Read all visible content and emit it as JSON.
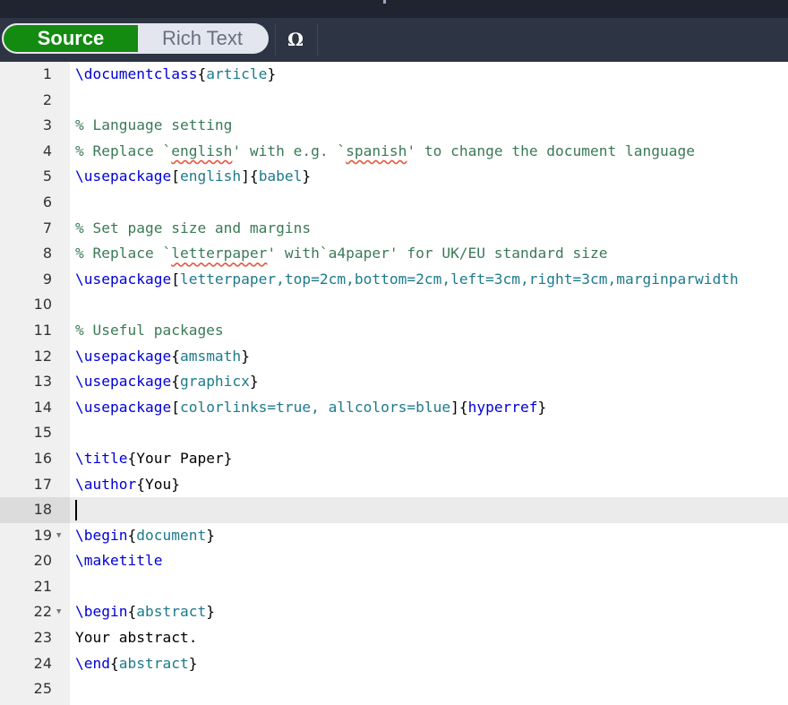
{
  "toolbar": {
    "mode_toggle": {
      "source_label": "Source",
      "rich_text_label": "Rich Text",
      "active": "Source"
    },
    "symbol_button_label": "Ω"
  },
  "colors": {
    "source_active": "#138a10",
    "command": "#0000d8",
    "argument": "#1e7a8c",
    "comment": "#3b7a57",
    "spellcheck_underline": "#e8553a"
  },
  "editor": {
    "active_line": 18,
    "lines": [
      {
        "n": "1",
        "tokens": [
          {
            "t": "cmd",
            "v": "\\documentclass"
          },
          {
            "t": "txt",
            "v": "{"
          },
          {
            "t": "arg",
            "v": "article"
          },
          {
            "t": "txt",
            "v": "}"
          }
        ]
      },
      {
        "n": "2",
        "tokens": []
      },
      {
        "n": "3",
        "tokens": [
          {
            "t": "cmt",
            "v": "% Language setting"
          }
        ]
      },
      {
        "n": "4",
        "tokens": [
          {
            "t": "cmt",
            "v": "% Replace `"
          },
          {
            "t": "cmt err",
            "v": "english"
          },
          {
            "t": "cmt",
            "v": "' with e.g. `"
          },
          {
            "t": "cmt err",
            "v": "spanish"
          },
          {
            "t": "cmt",
            "v": "' to change the document language"
          }
        ]
      },
      {
        "n": "5",
        "tokens": [
          {
            "t": "cmd",
            "v": "\\usepackage"
          },
          {
            "t": "txt",
            "v": "["
          },
          {
            "t": "arg",
            "v": "english"
          },
          {
            "t": "txt",
            "v": "]{"
          },
          {
            "t": "arg",
            "v": "babel"
          },
          {
            "t": "txt",
            "v": "}"
          }
        ]
      },
      {
        "n": "6",
        "tokens": []
      },
      {
        "n": "7",
        "tokens": [
          {
            "t": "cmt",
            "v": "% Set page size and margins"
          }
        ]
      },
      {
        "n": "8",
        "tokens": [
          {
            "t": "cmt",
            "v": "% Replace `"
          },
          {
            "t": "cmt err",
            "v": "letterpaper"
          },
          {
            "t": "cmt",
            "v": "' with`a4paper' for UK/EU standard size"
          }
        ]
      },
      {
        "n": "9",
        "tokens": [
          {
            "t": "cmd",
            "v": "\\usepackage"
          },
          {
            "t": "txt",
            "v": "["
          },
          {
            "t": "arg",
            "v": "letterpaper,top=2cm,bottom=2cm,left=3cm,right=3cm,marginparwidth"
          }
        ]
      },
      {
        "n": "10",
        "tokens": []
      },
      {
        "n": "11",
        "tokens": [
          {
            "t": "cmt",
            "v": "% Useful packages"
          }
        ]
      },
      {
        "n": "12",
        "tokens": [
          {
            "t": "cmd",
            "v": "\\usepackage"
          },
          {
            "t": "txt",
            "v": "{"
          },
          {
            "t": "arg",
            "v": "amsmath"
          },
          {
            "t": "txt",
            "v": "}"
          }
        ]
      },
      {
        "n": "13",
        "tokens": [
          {
            "t": "cmd",
            "v": "\\usepackage"
          },
          {
            "t": "txt",
            "v": "{"
          },
          {
            "t": "arg",
            "v": "graphicx"
          },
          {
            "t": "txt",
            "v": "}"
          }
        ]
      },
      {
        "n": "14",
        "tokens": [
          {
            "t": "cmd",
            "v": "\\usepackage"
          },
          {
            "t": "txt",
            "v": "["
          },
          {
            "t": "arg",
            "v": "colorlinks=true, allcolors=blue"
          },
          {
            "t": "txt",
            "v": "]{"
          },
          {
            "t": "cmd",
            "v": "hyperref"
          },
          {
            "t": "txt",
            "v": "}"
          }
        ]
      },
      {
        "n": "15",
        "tokens": []
      },
      {
        "n": "16",
        "tokens": [
          {
            "t": "cmd",
            "v": "\\title"
          },
          {
            "t": "txt",
            "v": "{Your Paper}"
          }
        ]
      },
      {
        "n": "17",
        "tokens": [
          {
            "t": "cmd",
            "v": "\\author"
          },
          {
            "t": "txt",
            "v": "{You}"
          }
        ]
      },
      {
        "n": "18",
        "tokens": []
      },
      {
        "n": "19",
        "fold": true,
        "tokens": [
          {
            "t": "cmd",
            "v": "\\begin"
          },
          {
            "t": "txt",
            "v": "{"
          },
          {
            "t": "arg",
            "v": "document"
          },
          {
            "t": "txt",
            "v": "}"
          }
        ]
      },
      {
        "n": "20",
        "tokens": [
          {
            "t": "cmd",
            "v": "\\maketitle"
          }
        ]
      },
      {
        "n": "21",
        "tokens": []
      },
      {
        "n": "22",
        "fold": true,
        "tokens": [
          {
            "t": "cmd",
            "v": "\\begin"
          },
          {
            "t": "txt",
            "v": "{"
          },
          {
            "t": "arg",
            "v": "abstract"
          },
          {
            "t": "txt",
            "v": "}"
          }
        ]
      },
      {
        "n": "23",
        "tokens": [
          {
            "t": "txt",
            "v": "Your abstract."
          }
        ]
      },
      {
        "n": "24",
        "tokens": [
          {
            "t": "cmd",
            "v": "\\end"
          },
          {
            "t": "txt",
            "v": "{"
          },
          {
            "t": "arg",
            "v": "abstract"
          },
          {
            "t": "txt",
            "v": "}"
          }
        ]
      },
      {
        "n": "25",
        "tokens": []
      }
    ]
  }
}
